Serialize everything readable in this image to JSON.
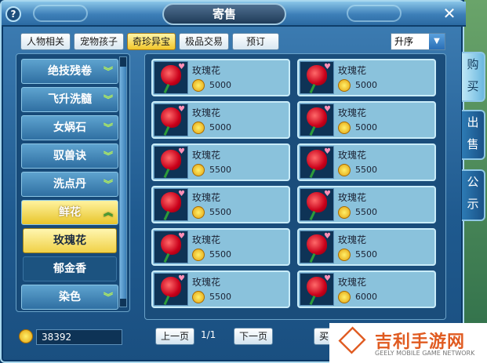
{
  "window": {
    "title": "寄售",
    "help_icon": "?",
    "close_icon": "✕"
  },
  "tabs": [
    {
      "label": "人物相关"
    },
    {
      "label": "宠物孩子"
    },
    {
      "label": "奇珍异宝"
    },
    {
      "label": "极品交易"
    },
    {
      "label": "预订"
    }
  ],
  "sort": {
    "value": "升序"
  },
  "categories": [
    {
      "label": "绝技残卷"
    },
    {
      "label": "飞升洗髓"
    },
    {
      "label": "女娲石"
    },
    {
      "label": "驭兽诀"
    },
    {
      "label": "洗点丹"
    },
    {
      "label": "鲜花"
    },
    {
      "label": "染色"
    }
  ],
  "subcategories": [
    {
      "label": "玫瑰花"
    },
    {
      "label": "郁金香"
    }
  ],
  "items": [
    {
      "name": "玫瑰花",
      "price": "5000"
    },
    {
      "name": "玫瑰花",
      "price": "5000"
    },
    {
      "name": "玫瑰花",
      "price": "5000"
    },
    {
      "name": "玫瑰花",
      "price": "5000"
    },
    {
      "name": "玫瑰花",
      "price": "5500"
    },
    {
      "name": "玫瑰花",
      "price": "5500"
    },
    {
      "name": "玫瑰花",
      "price": "5500"
    },
    {
      "name": "玫瑰花",
      "price": "5500"
    },
    {
      "name": "玫瑰花",
      "price": "5500"
    },
    {
      "name": "玫瑰花",
      "price": "5500"
    },
    {
      "name": "玫瑰花",
      "price": "5500"
    },
    {
      "name": "玫瑰花",
      "price": "6000"
    }
  ],
  "footer": {
    "money": "38392",
    "prev_label": "上一页",
    "next_label": "下一页",
    "page_info": "1/1",
    "buy_peek": "买"
  },
  "side_tabs": [
    {
      "label": "购买"
    },
    {
      "label": "出售"
    },
    {
      "label": "公示"
    }
  ],
  "watermark": {
    "cn": "吉利手游网",
    "en": "GEELY MOBILE GAME NETWORK"
  }
}
